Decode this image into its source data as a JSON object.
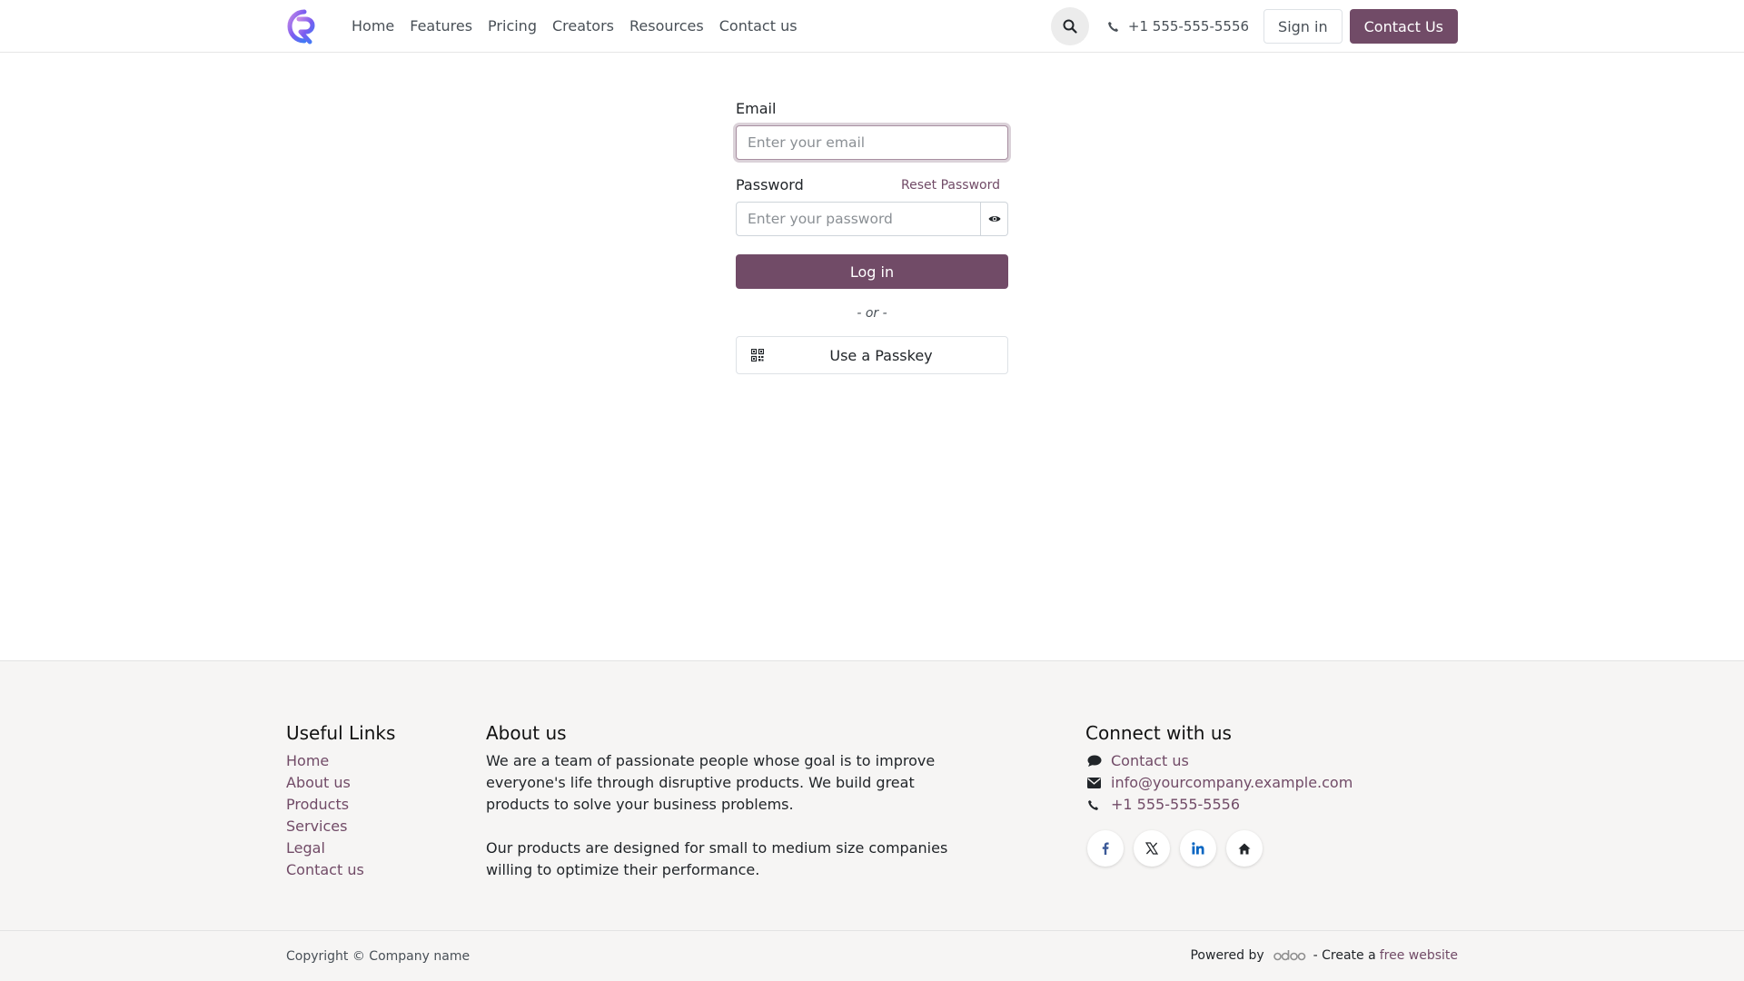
{
  "header": {
    "nav": [
      "Home",
      "Features",
      "Pricing",
      "Creators",
      "Resources",
      "Contact us"
    ],
    "phone": "+1 555-555-5556",
    "signin_label": "Sign in",
    "contact_label": "Contact Us"
  },
  "login": {
    "email_label": "Email",
    "email_placeholder": "Enter your email",
    "password_label": "Password",
    "reset_label": "Reset Password",
    "password_placeholder": "Enter your password",
    "login_label": "Log in",
    "or_label": "- or -",
    "passkey_label": "Use a Passkey"
  },
  "footer": {
    "useful_title": "Useful Links",
    "useful_links": [
      "Home",
      "About us",
      "Products",
      "Services",
      "Legal",
      "Contact us"
    ],
    "about_title": "About us",
    "about_p1": "We are a team of passionate people whose goal is to improve everyone's life through disruptive products. We build great products to solve your business problems.",
    "about_p2": "Our products are designed for small to medium size companies willing to optimize their performance.",
    "connect_title": "Connect with us",
    "connect_contact": "Contact us",
    "connect_email": "info@yourcompany.example.com",
    "connect_phone": "+1 555-555-5556",
    "socials": [
      "facebook-icon",
      "x-icon",
      "linkedin-icon",
      "home-icon"
    ],
    "copyright": "Copyright © Company name",
    "powered_by": "Powered by",
    "create_text": "- Create a",
    "free_website": "free website"
  },
  "colors": {
    "brand": "#714b67",
    "footer_bg": "#f6f5f4"
  }
}
